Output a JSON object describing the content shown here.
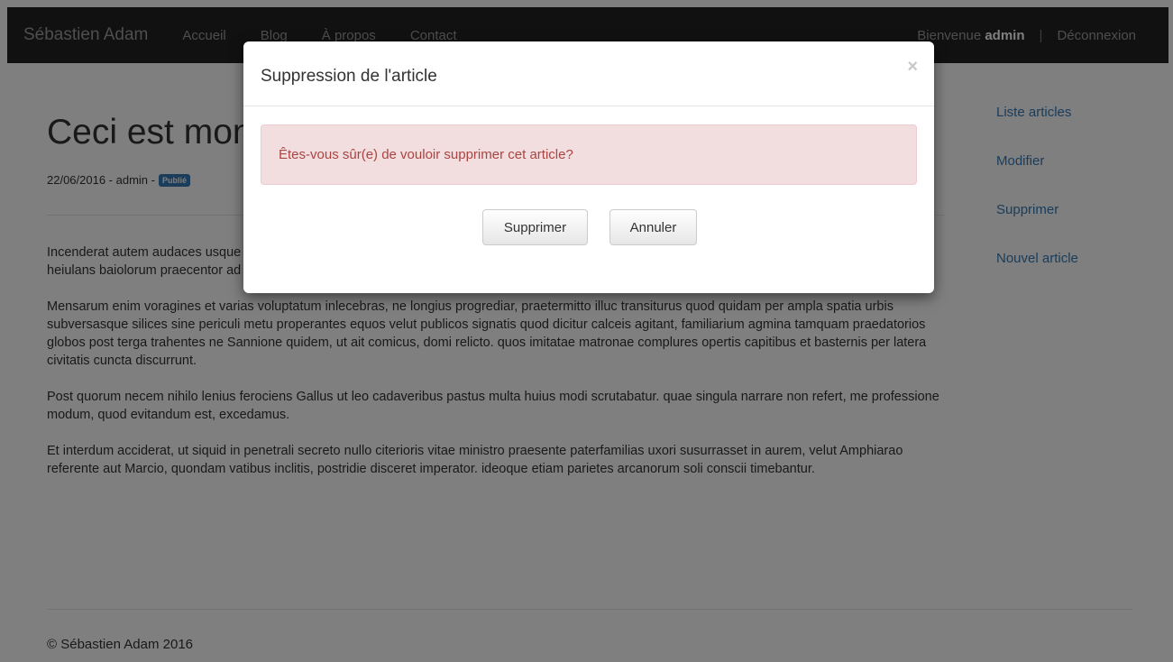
{
  "navbar": {
    "brand": "Sébastien Adam",
    "links": [
      "Accueil",
      "Blog",
      "À propos",
      "Contact"
    ],
    "welcome_prefix": "Bienvenue",
    "welcome_user": "admin",
    "separator": "|",
    "logout": "Déconnexion"
  },
  "article": {
    "title": "Ceci est mon premier article",
    "meta": "22/06/2016 - admin -",
    "status_badge": "Publié",
    "paragraphs": [
      "Incenderat autem audaces usque ad insaniam homines ad haec, quae nefariis egere conatibus, Luscus quidam curator urbis subito visus: eosque ut heiulans baiolorum praecentor ad expediendum quod orsi sunt incitans vocibus crebris. qui haut longe postea ideo vivus exustus est.",
      "Mensarum enim voragines et varias voluptatum inlecebras, ne longius progrediar, praetermitto illuc transiturus quod quidam per ampla spatia urbis subversasque silices sine periculi metu properantes equos velut publicos signatis quod dicitur calceis agitant, familiarium agmina tamquam praedatorios globos post terga trahentes ne Sannione quidem, ut ait comicus, domi relicto. quos imitatae matronae complures opertis capitibus et basternis per latera civitatis cuncta discurrunt.",
      "Post quorum necem nihilo lenius ferociens Gallus ut leo cadaveribus pastus multa huius modi scrutabatur. quae singula narrare non refert, me professione modum, quod evitandum est, excedamus.",
      "Et interdum acciderat, ut siquid in penetrali secreto nullo citerioris vitae ministro praesente paterfamilias uxori susurrasset in aurem, velut Amphiarao referente aut Marcio, quondam vatibus inclitis, postridie disceret imperator. ideoque etiam parietes arcanorum soli conscii timebantur."
    ]
  },
  "sidebar": {
    "items": [
      "Liste articles",
      "Modifier",
      "Supprimer",
      "Nouvel article"
    ]
  },
  "footer": {
    "text": "© Sébastien Adam 2016"
  },
  "modal": {
    "title": "Suppression de l'article",
    "close_symbol": "×",
    "message": "Êtes-vous sûr(e) de vouloir supprimer cet article?",
    "confirm_label": "Supprimer",
    "cancel_label": "Annuler"
  }
}
